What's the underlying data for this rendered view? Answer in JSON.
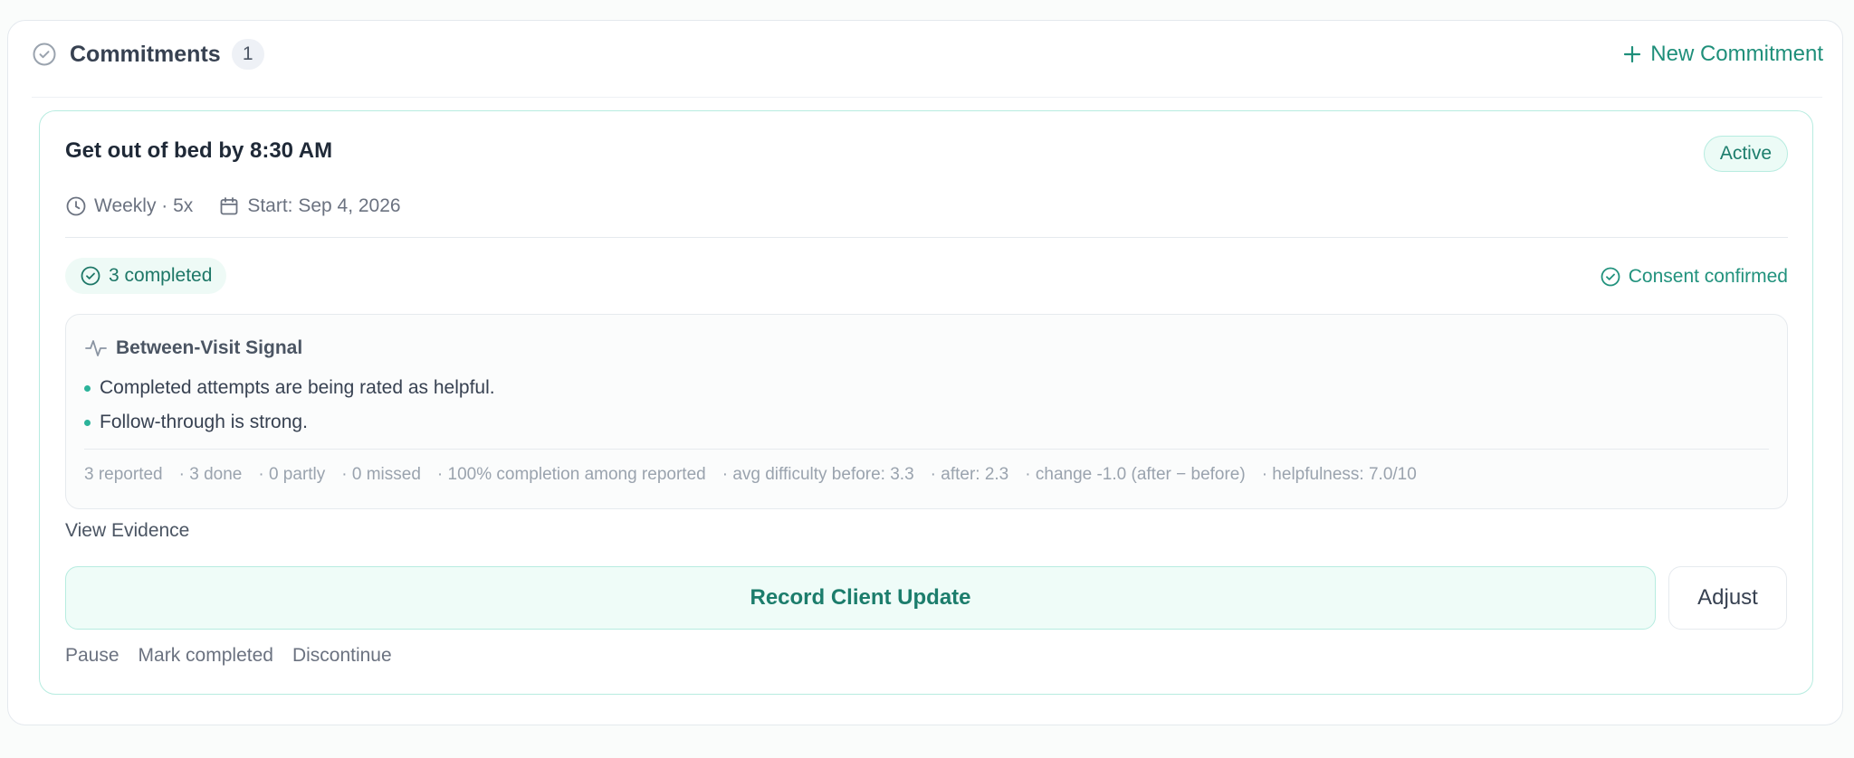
{
  "header": {
    "title": "Commitments",
    "count": "1",
    "new_button_label": "New Commitment",
    "icons": {
      "section": "check-circle-icon",
      "new": "plus-icon"
    }
  },
  "commitment": {
    "title": "Get out of bed by 8:30 AM",
    "status": "Active",
    "frequency": "Weekly · 5x",
    "start": "Start: Sep 4, 2026",
    "completed_label": "3 completed",
    "consent_label": "Consent confirmed",
    "signal": {
      "title": "Between-Visit Signal",
      "bullets": [
        "Completed attempts are being rated as helpful.",
        "Follow-through is strong."
      ],
      "stats": [
        "3 reported",
        "· 3 done",
        "· 0 partly",
        "· 0 missed",
        "· 100% completion among reported",
        "· avg difficulty before: 3.3",
        "· after: 2.3",
        "· change -1.0 (after − before)",
        "· helpfulness: 7.0/10"
      ]
    },
    "view_evidence_label": "View Evidence",
    "record_button_label": "Record Client Update",
    "adjust_button_label": "Adjust",
    "actions": [
      "Pause",
      "Mark completed",
      "Discontinue"
    ]
  },
  "colors": {
    "accent": "#1f8f7a",
    "accent_border": "#b7ece0",
    "accent_bg": "#effcf8",
    "text_muted": "#6b7280"
  }
}
